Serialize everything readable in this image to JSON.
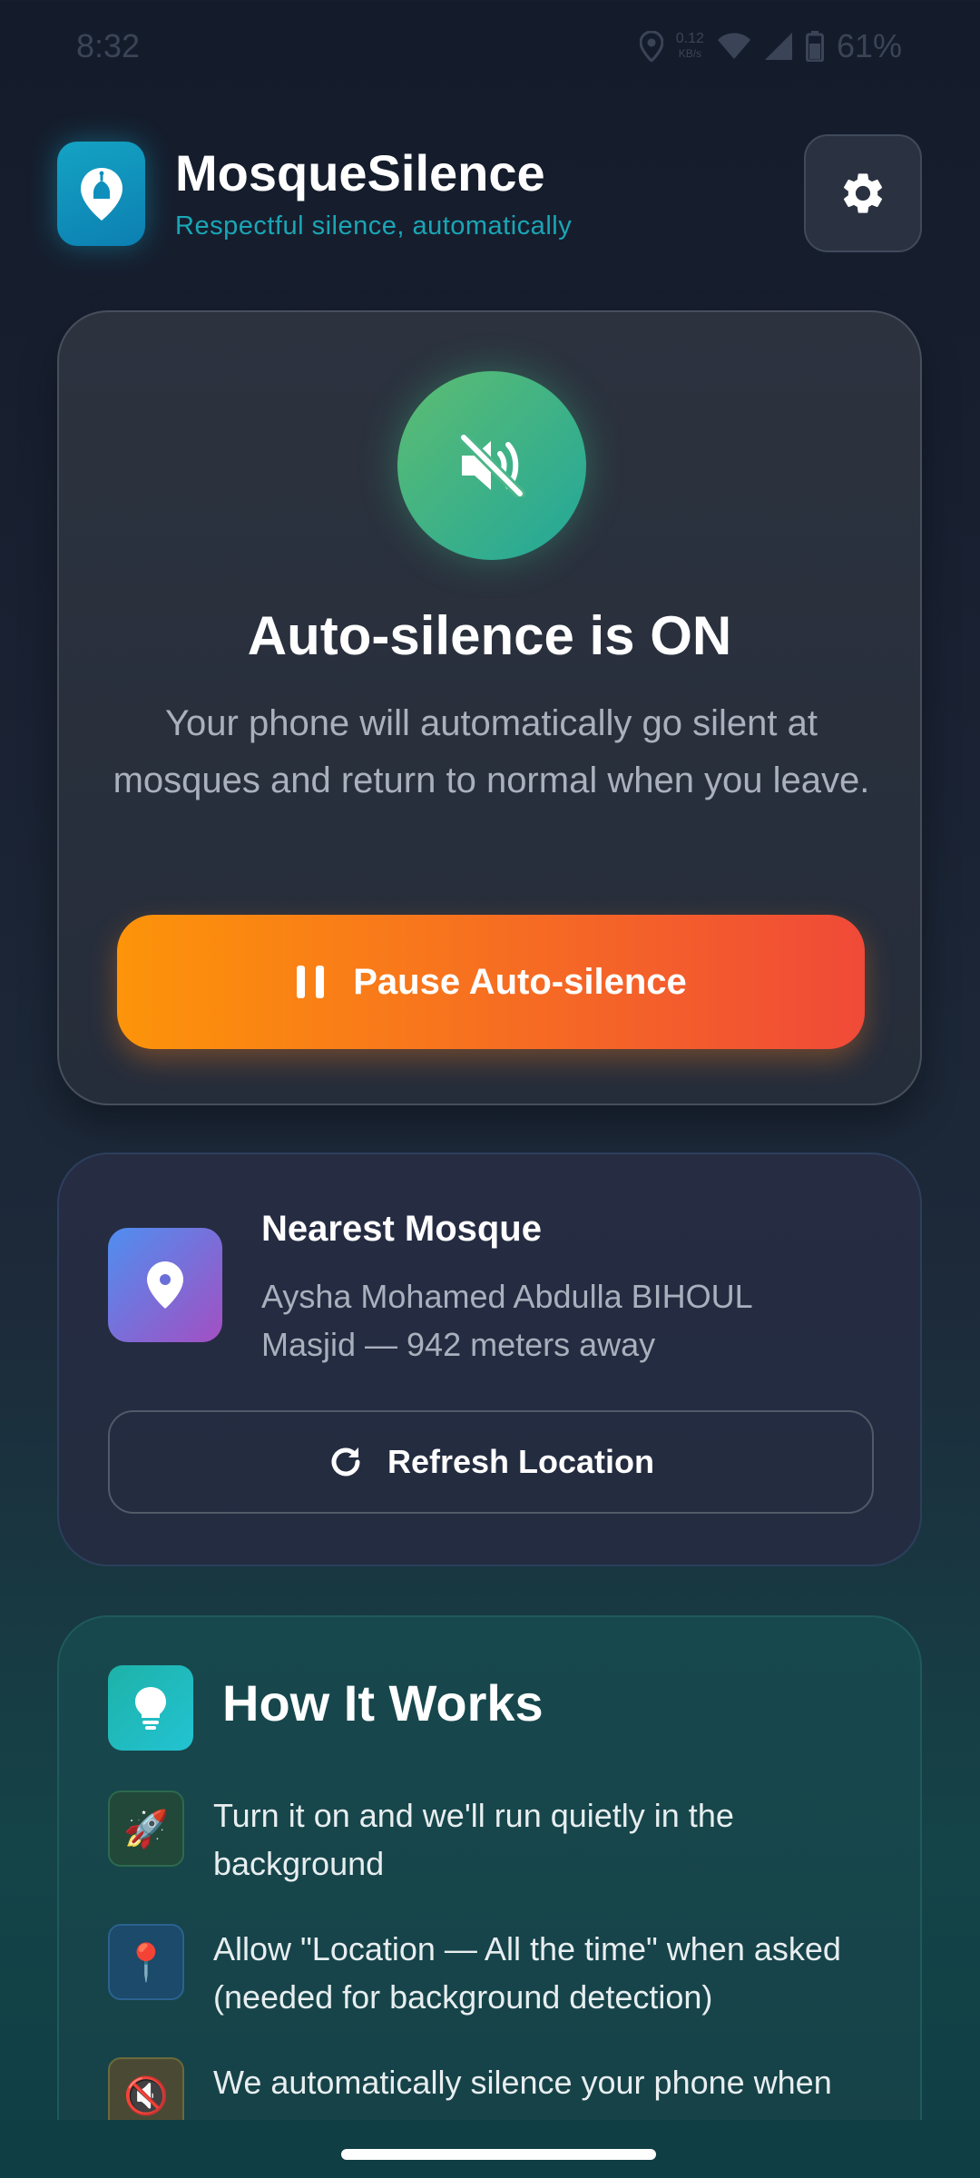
{
  "status_bar": {
    "time": "8:32",
    "net_speed_top": "0.12",
    "net_speed_bottom": "KB/s",
    "battery": "61%"
  },
  "header": {
    "title": "MosqueSilence",
    "subtitle": "Respectful silence, automatically",
    "icons": {
      "logo": "mosque-pin-icon",
      "settings": "gear-icon"
    }
  },
  "status_card": {
    "icon": "speaker-muted-icon",
    "title": "Auto-silence is ON",
    "description": "Your phone will automatically go silent at mosques and return to normal when you leave.",
    "pause_button_label": "Pause Auto-silence",
    "pause_icon": "pause-icon"
  },
  "mosque_card": {
    "icon": "location-pin-icon",
    "heading": "Nearest Mosque",
    "detail": "Aysha Mohamed Abdulla BIHOUL Masjid — 942 meters away",
    "refresh_label": "Refresh Location",
    "refresh_icon": "refresh-icon"
  },
  "how_it_works": {
    "icon": "lightbulb-icon",
    "title": "How It Works",
    "steps": [
      {
        "emoji": "🚀",
        "text": "Turn it on and we'll run quietly in the background"
      },
      {
        "emoji": "📍",
        "text": "Allow \"Location — All the time\" when asked (needed for background detection)"
      },
      {
        "emoji": "🔇",
        "text": "We automatically silence your phone when"
      }
    ]
  },
  "colors": {
    "accent_teal": "#1aa6b6",
    "active_green": "#3fb384",
    "pause_orange": "#fd9409",
    "pause_red": "#f04a38"
  }
}
